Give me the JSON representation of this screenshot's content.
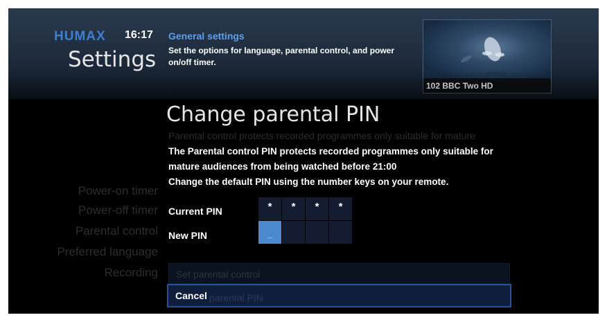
{
  "header": {
    "brand": "HUMAX",
    "time": "16:17",
    "title": "Settings",
    "section_name": "General settings",
    "section_description": "Set the options for language, parental control, and power on/off timer."
  },
  "preview": {
    "channel": "102 BBC Two HD"
  },
  "settings_menu": {
    "items": [
      "Power-on timer",
      "Power-off timer",
      "Parental control",
      "Preferred language",
      "Recording"
    ]
  },
  "background_options": {
    "description": "Parental control protects recorded programmes only suitable for mature",
    "set_parental_control": "Set parental control",
    "change_parental_pin": "parental PIN"
  },
  "dialog": {
    "title": "Change parental PIN",
    "line1": "The Parental control PIN protects recorded programmes only suitable for",
    "line2": "mature audiences from being watched before 21:00",
    "line3": "Change the default PIN using the number keys on your remote.",
    "current_pin_label": "Current PIN",
    "current_pin": [
      "*",
      "*",
      "*",
      "*"
    ],
    "new_pin_label": "New PIN",
    "new_pin": [
      "_",
      "",
      "",
      ""
    ],
    "cancel_label": "Cancel"
  },
  "colors": {
    "brand": "#3d7fd0",
    "section_title": "#59a0f0",
    "active_pin_cell": "#4a88cf",
    "focus_border": "#2c4f9c"
  }
}
